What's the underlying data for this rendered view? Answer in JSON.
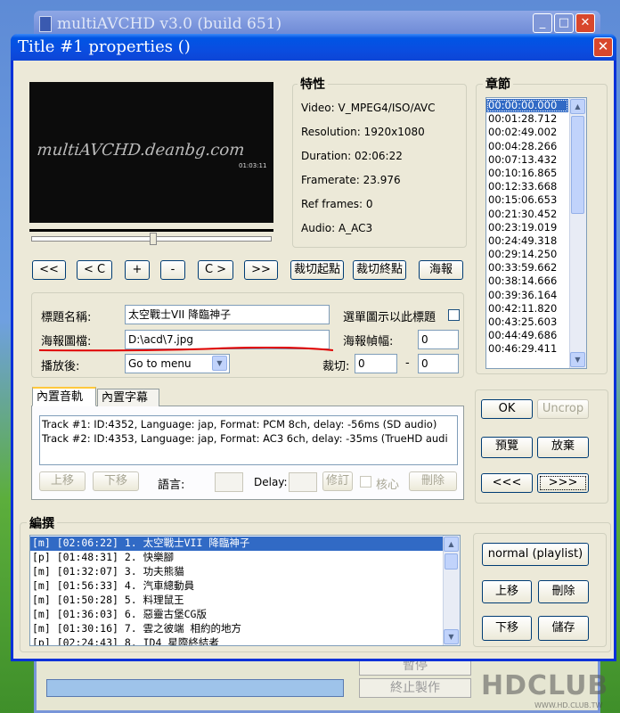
{
  "bg_window": {
    "title": "multiAVCHD v3.0 (build 651)",
    "btn_label": "暫停",
    "stop_label": "終止製作",
    "min": "_",
    "max": "□",
    "close": "✕"
  },
  "watermark": {
    "brand": "HDCLUB",
    "url": "WWW.HD.CLUB.TW"
  },
  "dialog": {
    "title": "Title #1 properties ()",
    "close": "✕"
  },
  "video": {
    "watermark": "multiAVCHD.deanbg.com",
    "timecode": "01:03:11"
  },
  "transport": {
    "prev": "<<",
    "prev_c": "< C",
    "plus": "+",
    "minus": "-",
    "next_c": "C >",
    "next": ">>",
    "cut_start": "裁切起點",
    "cut_end": "裁切終點",
    "poster": "海報"
  },
  "props": {
    "heading": "特性",
    "video": "Video: V_MPEG4/ISO/AVC",
    "resolution": "Resolution: 1920x1080",
    "duration": "Duration: 02:06:22",
    "framerate": "Framerate: 23.976",
    "ref_frames": "Ref frames: 0",
    "audio": "Audio: A_AC3"
  },
  "chapters": {
    "heading": "章節",
    "items": [
      "00:00:00.000",
      "00:01:28.712",
      "00:02:49.002",
      "00:04:28.266",
      "00:07:13.432",
      "00:10:16.865",
      "00:12:33.668",
      "00:15:06.653",
      "00:21:30.452",
      "00:23:19.019",
      "00:24:49.318",
      "00:29:14.250",
      "00:33:59.662",
      "00:38:14.666",
      "00:39:36.164",
      "00:42:11.820",
      "00:43:25.603",
      "00:44:49.686",
      "00:46:29.411"
    ]
  },
  "form": {
    "title_label": "標題名稱:",
    "title_value": "太空戰士VII 降臨神子",
    "menu_icon_label": "選單圖示以此標題",
    "poster_label": "海報圖檔:",
    "poster_value": "D:\\acd\\7.jpg",
    "poster_frame_label": "海報幀幅:",
    "poster_frame_value": "0",
    "after_play_label": "播放後:",
    "after_play_value": "Go to menu",
    "crop_label": "裁切:",
    "crop_from": "0",
    "crop_dash": "-",
    "crop_to": "0"
  },
  "tabs": {
    "audio": "內置音軌",
    "subs": "內置字幕"
  },
  "tracks": [
    "Track #1: ID:4352, Language: jap, Format: PCM 8ch, delay: -56ms (SD audio)",
    "Track #2: ID:4353, Language: jap, Format: AC3 6ch, delay: -35ms (TrueHD audi"
  ],
  "track_ctrl": {
    "up": "上移",
    "down": "下移",
    "lang_label": "語言:",
    "delay_label": "Delay:",
    "modify": "修訂",
    "core": "核心",
    "delete": "刪除"
  },
  "right_btns": {
    "ok": "OK",
    "uncrop": "Uncrop",
    "preview": "預覽",
    "discard": "放棄",
    "prev": "<<<",
    "next": ">>>"
  },
  "compile": {
    "heading": "編撰",
    "items": [
      "[m] [02:06:22] 1. 太空戰士VII 降臨神子",
      "[p] [01:48:31] 2. 快樂腳",
      "[m] [01:32:07] 3. 功夫熊貓",
      "[m] [01:56:33] 4. 汽車總動員",
      "[m] [01:50:28] 5. 料理鼠王",
      "[m] [01:36:03] 6. 惡靈古堡CG版",
      "[m] [01:30:16] 7. 雲之彼端 相約的地方",
      "[p] [02:24:43] 8. ID4 星際終結者"
    ],
    "normal": "normal (playlist)",
    "up": "上移",
    "delete": "刪除",
    "down": "下移",
    "save": "儲存"
  }
}
